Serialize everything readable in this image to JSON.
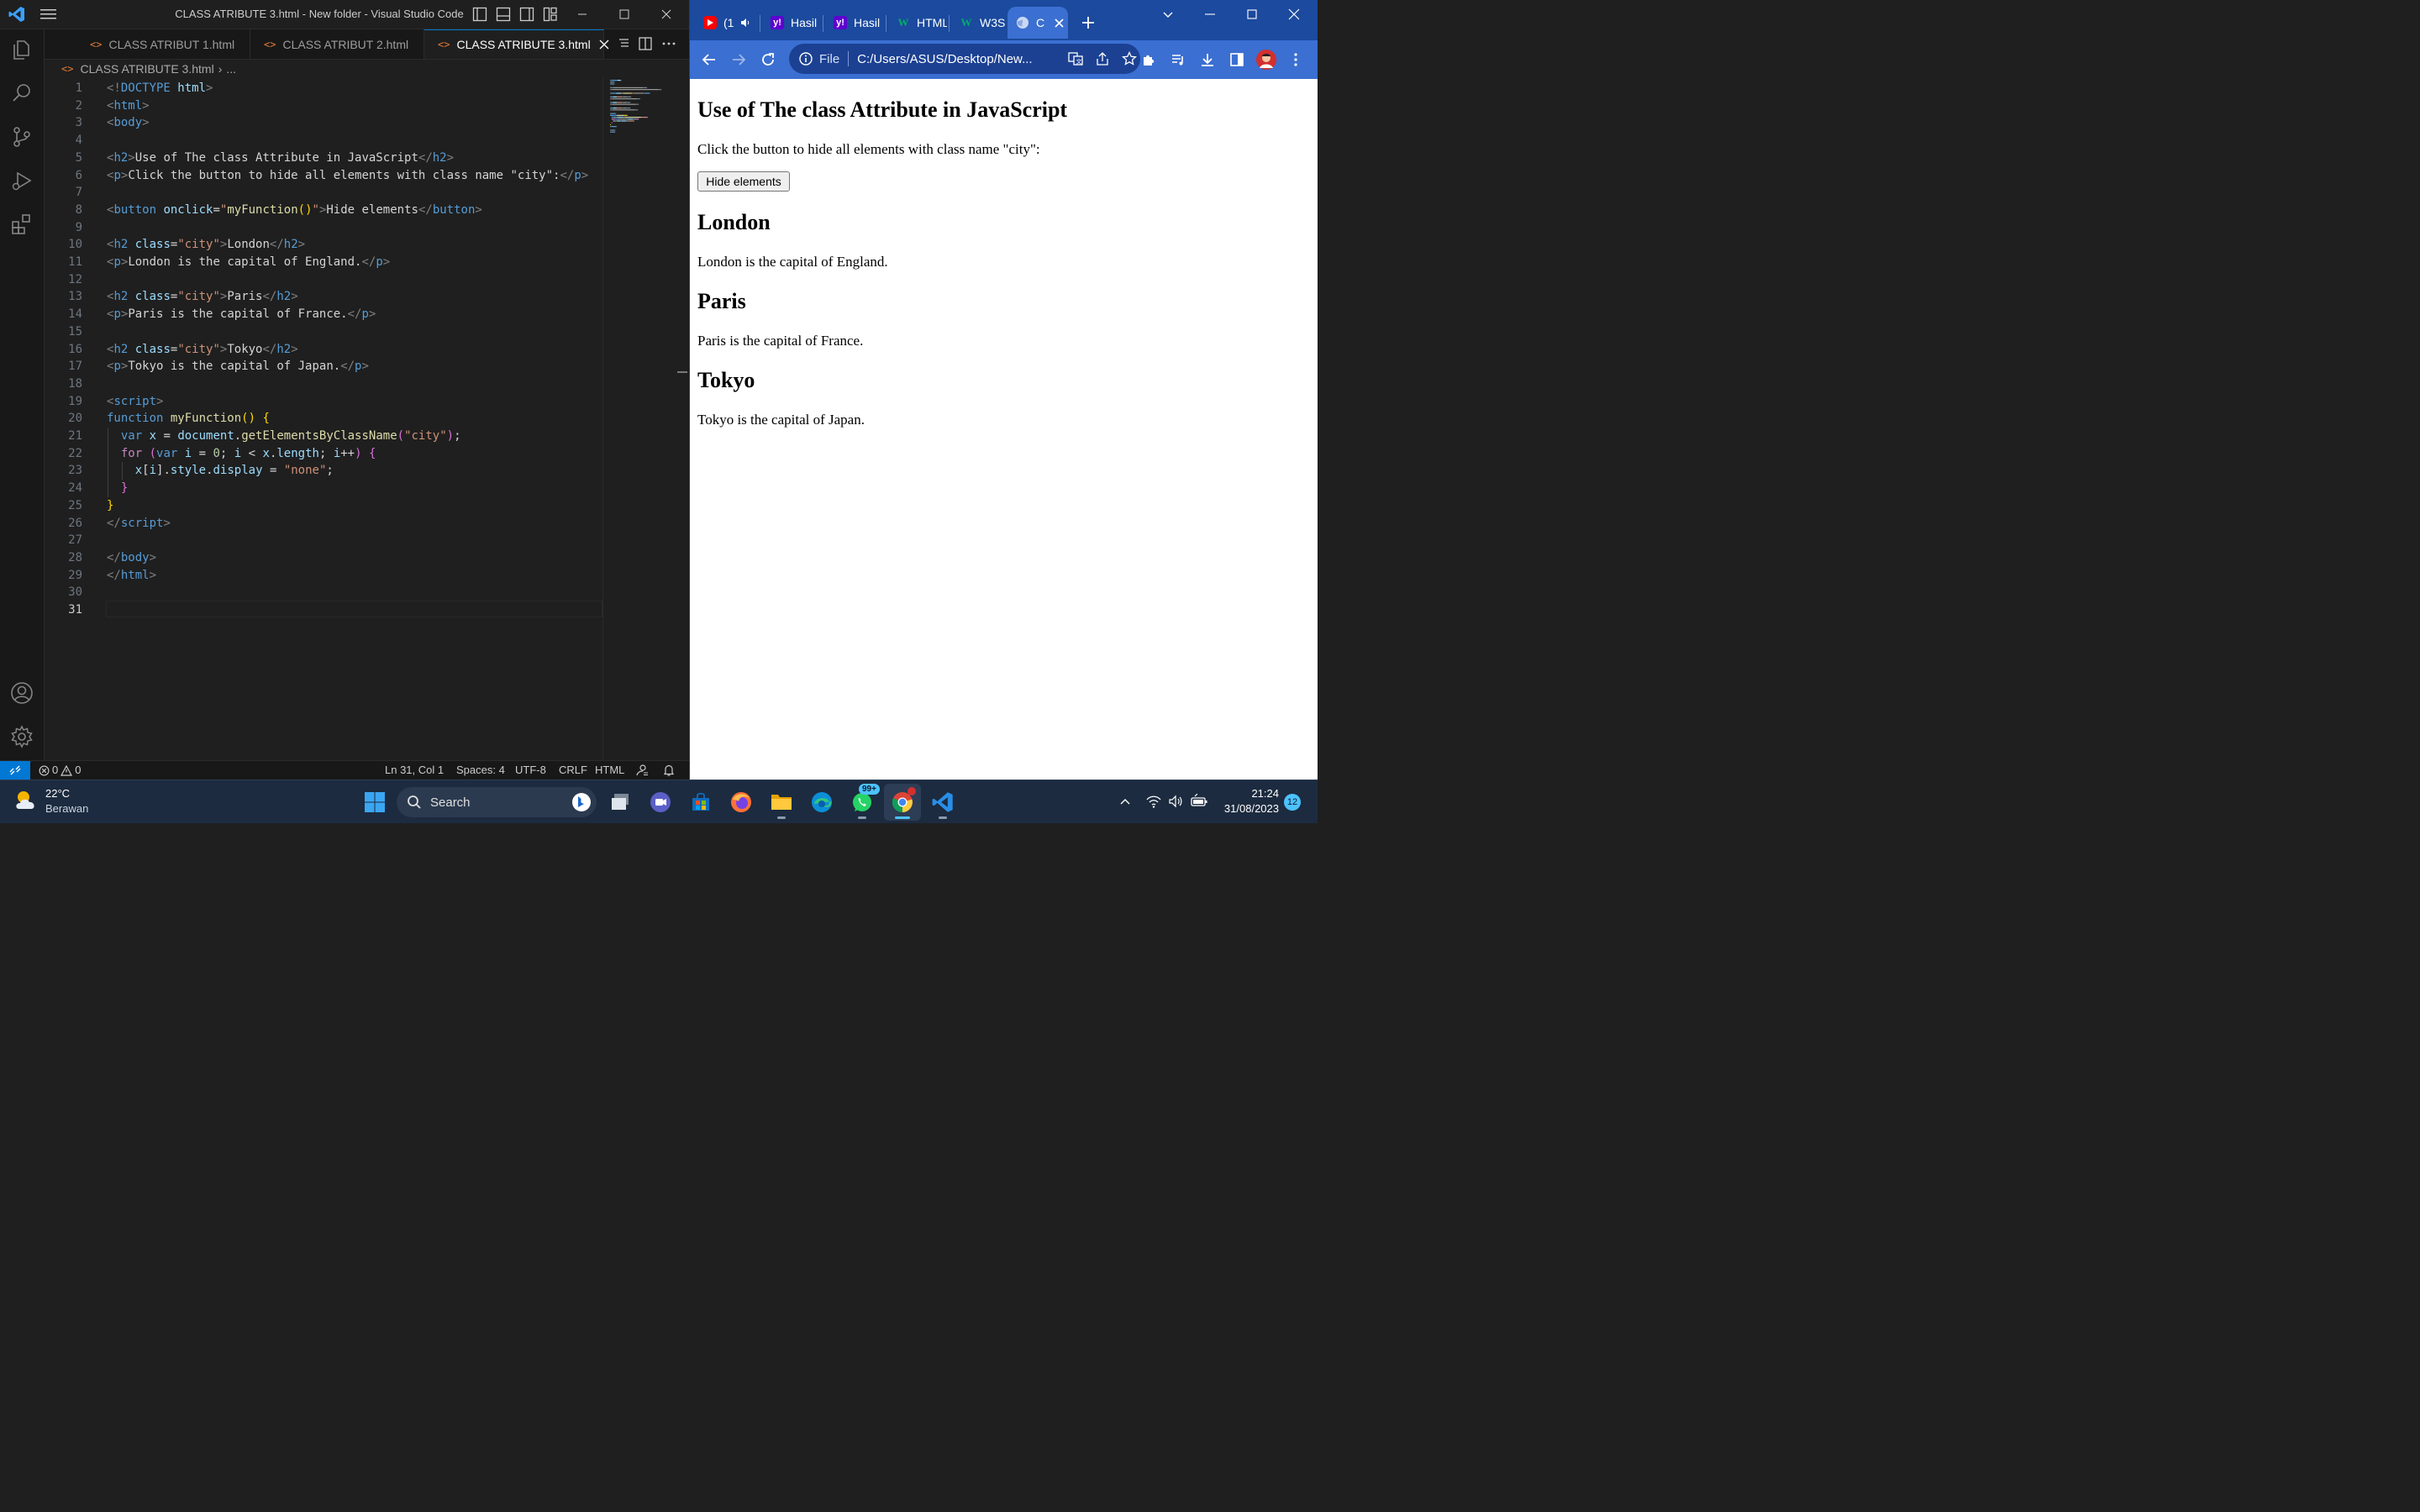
{
  "vscode": {
    "window_title": "CLASS ATRIBUTE 3.html - New folder - Visual Studio Code",
    "tabs": [
      {
        "label": "CLASS ATRIBUT 1.html",
        "active": false
      },
      {
        "label": "CLASS ATRIBUT 2.html",
        "active": false
      },
      {
        "label": "CLASS ATRIBUTE 3.html",
        "active": true
      }
    ],
    "breadcrumb": {
      "file": "CLASS ATRIBUTE 3.html",
      "rest": "..."
    },
    "code_lines": [
      {
        "n": "1",
        "tokens": [
          {
            "t": "<!",
            "c": "t-brk"
          },
          {
            "t": "DOCTYPE ",
            "c": "t-tag"
          },
          {
            "t": "html",
            "c": "t-attr"
          },
          {
            "t": ">",
            "c": "t-brk"
          }
        ]
      },
      {
        "n": "2",
        "tokens": [
          {
            "t": "<",
            "c": "t-brk"
          },
          {
            "t": "html",
            "c": "t-tag"
          },
          {
            "t": ">",
            "c": "t-brk"
          }
        ]
      },
      {
        "n": "3",
        "tokens": [
          {
            "t": "<",
            "c": "t-brk"
          },
          {
            "t": "body",
            "c": "t-tag"
          },
          {
            "t": ">",
            "c": "t-brk"
          }
        ]
      },
      {
        "n": "4",
        "tokens": []
      },
      {
        "n": "5",
        "tokens": [
          {
            "t": "<",
            "c": "t-brk"
          },
          {
            "t": "h2",
            "c": "t-tag"
          },
          {
            "t": ">",
            "c": "t-brk"
          },
          {
            "t": "Use of The class Attribute in JavaScript",
            "c": "t-txt"
          },
          {
            "t": "</",
            "c": "t-brk"
          },
          {
            "t": "h2",
            "c": "t-tag"
          },
          {
            "t": ">",
            "c": "t-brk"
          }
        ]
      },
      {
        "n": "6",
        "tokens": [
          {
            "t": "<",
            "c": "t-brk"
          },
          {
            "t": "p",
            "c": "t-tag"
          },
          {
            "t": ">",
            "c": "t-brk"
          },
          {
            "t": "Click the button to hide all elements with class name \"city\":",
            "c": "t-txt"
          },
          {
            "t": "</",
            "c": "t-brk"
          },
          {
            "t": "p",
            "c": "t-tag"
          },
          {
            "t": ">",
            "c": "t-brk"
          }
        ]
      },
      {
        "n": "7",
        "tokens": []
      },
      {
        "n": "8",
        "tokens": [
          {
            "t": "<",
            "c": "t-brk"
          },
          {
            "t": "button ",
            "c": "t-tag"
          },
          {
            "t": "onclick",
            "c": "t-attr"
          },
          {
            "t": "=",
            "c": "t-txt"
          },
          {
            "t": "\"",
            "c": "t-str"
          },
          {
            "t": "myFunction",
            "c": "t-fn"
          },
          {
            "t": "()",
            "c": "t-b1"
          },
          {
            "t": "\"",
            "c": "t-str"
          },
          {
            "t": ">",
            "c": "t-brk"
          },
          {
            "t": "Hide elements",
            "c": "t-txt"
          },
          {
            "t": "</",
            "c": "t-brk"
          },
          {
            "t": "button",
            "c": "t-tag"
          },
          {
            "t": ">",
            "c": "t-brk"
          }
        ]
      },
      {
        "n": "9",
        "tokens": []
      },
      {
        "n": "10",
        "tokens": [
          {
            "t": "<",
            "c": "t-brk"
          },
          {
            "t": "h2 ",
            "c": "t-tag"
          },
          {
            "t": "class",
            "c": "t-attr"
          },
          {
            "t": "=",
            "c": "t-txt"
          },
          {
            "t": "\"city\"",
            "c": "t-str"
          },
          {
            "t": ">",
            "c": "t-brk"
          },
          {
            "t": "London",
            "c": "t-txt"
          },
          {
            "t": "</",
            "c": "t-brk"
          },
          {
            "t": "h2",
            "c": "t-tag"
          },
          {
            "t": ">",
            "c": "t-brk"
          }
        ]
      },
      {
        "n": "11",
        "tokens": [
          {
            "t": "<",
            "c": "t-brk"
          },
          {
            "t": "p",
            "c": "t-tag"
          },
          {
            "t": ">",
            "c": "t-brk"
          },
          {
            "t": "London is the capital of England.",
            "c": "t-txt"
          },
          {
            "t": "</",
            "c": "t-brk"
          },
          {
            "t": "p",
            "c": "t-tag"
          },
          {
            "t": ">",
            "c": "t-brk"
          }
        ]
      },
      {
        "n": "12",
        "tokens": []
      },
      {
        "n": "13",
        "tokens": [
          {
            "t": "<",
            "c": "t-brk"
          },
          {
            "t": "h2 ",
            "c": "t-tag"
          },
          {
            "t": "class",
            "c": "t-attr"
          },
          {
            "t": "=",
            "c": "t-txt"
          },
          {
            "t": "\"city\"",
            "c": "t-str"
          },
          {
            "t": ">",
            "c": "t-brk"
          },
          {
            "t": "Paris",
            "c": "t-txt"
          },
          {
            "t": "</",
            "c": "t-brk"
          },
          {
            "t": "h2",
            "c": "t-tag"
          },
          {
            "t": ">",
            "c": "t-brk"
          }
        ]
      },
      {
        "n": "14",
        "tokens": [
          {
            "t": "<",
            "c": "t-brk"
          },
          {
            "t": "p",
            "c": "t-tag"
          },
          {
            "t": ">",
            "c": "t-brk"
          },
          {
            "t": "Paris is the capital of France.",
            "c": "t-txt"
          },
          {
            "t": "</",
            "c": "t-brk"
          },
          {
            "t": "p",
            "c": "t-tag"
          },
          {
            "t": ">",
            "c": "t-brk"
          }
        ]
      },
      {
        "n": "15",
        "tokens": []
      },
      {
        "n": "16",
        "tokens": [
          {
            "t": "<",
            "c": "t-brk"
          },
          {
            "t": "h2 ",
            "c": "t-tag"
          },
          {
            "t": "class",
            "c": "t-attr"
          },
          {
            "t": "=",
            "c": "t-txt"
          },
          {
            "t": "\"city\"",
            "c": "t-str"
          },
          {
            "t": ">",
            "c": "t-brk"
          },
          {
            "t": "Tokyo",
            "c": "t-txt"
          },
          {
            "t": "</",
            "c": "t-brk"
          },
          {
            "t": "h2",
            "c": "t-tag"
          },
          {
            "t": ">",
            "c": "t-brk"
          }
        ]
      },
      {
        "n": "17",
        "tokens": [
          {
            "t": "<",
            "c": "t-brk"
          },
          {
            "t": "p",
            "c": "t-tag"
          },
          {
            "t": ">",
            "c": "t-brk"
          },
          {
            "t": "Tokyo is the capital of Japan.",
            "c": "t-txt"
          },
          {
            "t": "</",
            "c": "t-brk"
          },
          {
            "t": "p",
            "c": "t-tag"
          },
          {
            "t": ">",
            "c": "t-brk"
          }
        ]
      },
      {
        "n": "18",
        "tokens": []
      },
      {
        "n": "19",
        "tokens": [
          {
            "t": "<",
            "c": "t-brk"
          },
          {
            "t": "script",
            "c": "t-tag"
          },
          {
            "t": ">",
            "c": "t-brk"
          }
        ]
      },
      {
        "n": "20",
        "tokens": [
          {
            "t": "function ",
            "c": "t-kw"
          },
          {
            "t": "myFunction",
            "c": "t-fn"
          },
          {
            "t": "() {",
            "c": "t-b1"
          }
        ]
      },
      {
        "n": "21",
        "tokens": [
          {
            "t": "  ",
            "c": "t-txt"
          },
          {
            "t": "var ",
            "c": "t-kw"
          },
          {
            "t": "x",
            "c": "t-var"
          },
          {
            "t": " = ",
            "c": "t-txt"
          },
          {
            "t": "document",
            "c": "t-var"
          },
          {
            "t": ".",
            "c": "t-txt"
          },
          {
            "t": "getElementsByClassName",
            "c": "t-fn"
          },
          {
            "t": "(",
            "c": "t-b2"
          },
          {
            "t": "\"city\"",
            "c": "t-str"
          },
          {
            "t": ")",
            "c": "t-b2"
          },
          {
            "t": ";",
            "c": "t-txt"
          }
        ]
      },
      {
        "n": "22",
        "tokens": [
          {
            "t": "  ",
            "c": "t-txt"
          },
          {
            "t": "for ",
            "c": "t-ctrl"
          },
          {
            "t": "(",
            "c": "t-b2"
          },
          {
            "t": "var ",
            "c": "t-kw"
          },
          {
            "t": "i",
            "c": "t-var"
          },
          {
            "t": " = ",
            "c": "t-txt"
          },
          {
            "t": "0",
            "c": "t-num"
          },
          {
            "t": "; ",
            "c": "t-txt"
          },
          {
            "t": "i",
            "c": "t-var"
          },
          {
            "t": " < ",
            "c": "t-txt"
          },
          {
            "t": "x",
            "c": "t-var"
          },
          {
            "t": ".",
            "c": "t-txt"
          },
          {
            "t": "length",
            "c": "t-var"
          },
          {
            "t": "; ",
            "c": "t-txt"
          },
          {
            "t": "i",
            "c": "t-var"
          },
          {
            "t": "++",
            "c": "t-txt"
          },
          {
            "t": ") {",
            "c": "t-b2"
          }
        ]
      },
      {
        "n": "23",
        "tokens": [
          {
            "t": "    ",
            "c": "t-txt"
          },
          {
            "t": "x",
            "c": "t-var"
          },
          {
            "t": "[",
            "c": "t-txt"
          },
          {
            "t": "i",
            "c": "t-var"
          },
          {
            "t": "]",
            "c": "t-txt"
          },
          {
            "t": ".",
            "c": "t-txt"
          },
          {
            "t": "style",
            "c": "t-var"
          },
          {
            "t": ".",
            "c": "t-txt"
          },
          {
            "t": "display",
            "c": "t-var"
          },
          {
            "t": " = ",
            "c": "t-txt"
          },
          {
            "t": "\"none\"",
            "c": "t-str"
          },
          {
            "t": ";",
            "c": "t-txt"
          }
        ]
      },
      {
        "n": "24",
        "tokens": [
          {
            "t": "  ",
            "c": "t-txt"
          },
          {
            "t": "}",
            "c": "t-b2"
          }
        ]
      },
      {
        "n": "25",
        "tokens": [
          {
            "t": "}",
            "c": "t-b1"
          }
        ]
      },
      {
        "n": "26",
        "tokens": [
          {
            "t": "</",
            "c": "t-brk"
          },
          {
            "t": "script",
            "c": "t-tag"
          },
          {
            "t": ">",
            "c": "t-brk"
          }
        ]
      },
      {
        "n": "27",
        "tokens": []
      },
      {
        "n": "28",
        "tokens": [
          {
            "t": "</",
            "c": "t-brk"
          },
          {
            "t": "body",
            "c": "t-tag"
          },
          {
            "t": ">",
            "c": "t-brk"
          }
        ]
      },
      {
        "n": "29",
        "tokens": [
          {
            "t": "</",
            "c": "t-brk"
          },
          {
            "t": "html",
            "c": "t-tag"
          },
          {
            "t": ">",
            "c": "t-brk"
          }
        ]
      },
      {
        "n": "30",
        "tokens": []
      },
      {
        "n": "31",
        "tokens": []
      }
    ],
    "current_line": "31",
    "status": {
      "errors": "0",
      "warnings": "0",
      "cursor": "Ln 31, Col 1",
      "spaces": "Spaces: 4",
      "encoding": "UTF-8",
      "eol": "CRLF",
      "language": "HTML"
    },
    "colors": {
      "accent": "#0078d4",
      "background": "#1f1f1f"
    }
  },
  "chrome": {
    "tabs": [
      {
        "favicon": "youtube-icon",
        "label": "(1",
        "muted_icon": "speaker-icon"
      },
      {
        "favicon": "yahoo-icon",
        "label": "Hasil"
      },
      {
        "favicon": "yahoo-icon",
        "label": "Hasil"
      },
      {
        "favicon": "w3schools-icon",
        "label": "HTML"
      },
      {
        "favicon": "w3schools-icon",
        "label": "W3S"
      },
      {
        "favicon": "globe-icon",
        "label": "C",
        "active": true
      }
    ],
    "address": {
      "scheme_label": "File",
      "url": "C:/Users/ASUS/Desktop/New..."
    },
    "page": {
      "heading": "Use of The class Attribute in JavaScript",
      "instruction": "Click the button to hide all elements with class name \"city\":",
      "button_label": "Hide elements",
      "cities": [
        {
          "name": "London",
          "desc": "London is the capital of England."
        },
        {
          "name": "Paris",
          "desc": "Paris is the capital of France."
        },
        {
          "name": "Tokyo",
          "desc": "Tokyo is the capital of Japan."
        }
      ]
    },
    "colors": {
      "frame": "#1b4a9e",
      "toolbar": "#3b6fd1"
    }
  },
  "taskbar": {
    "weather": {
      "temp": "22°C",
      "desc": "Berawan"
    },
    "search_placeholder": "Search",
    "apps": [
      "start-icon",
      "search",
      "task-view-icon",
      "teams-icon",
      "store-icon",
      "firefox-icon",
      "file-explorer-icon",
      "edge-icon",
      "whatsapp-icon",
      "chrome-icon",
      "vscode-icon"
    ],
    "whatsapp_badge": "99+",
    "clock": {
      "time": "21:24",
      "date": "31/08/2023"
    },
    "notification_count": "12"
  }
}
